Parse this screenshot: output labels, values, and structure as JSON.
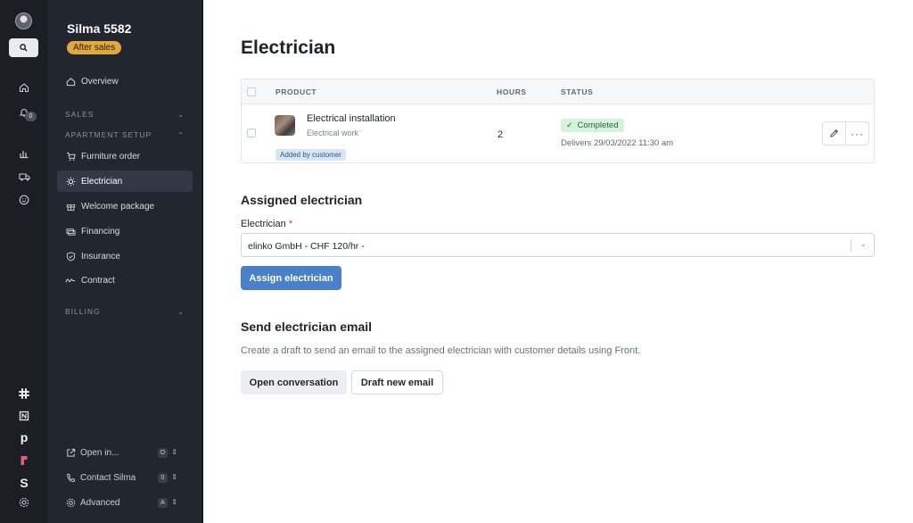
{
  "rail": {
    "icons": [
      "avatar",
      "search-icon",
      "home-icon",
      "bell-icon",
      "chart-icon",
      "truck-icon",
      "smile-icon",
      "slack-icon",
      "notion-icon",
      "pipedrive-icon",
      "figma-icon",
      "stripe-icon",
      "gear-icon"
    ],
    "notification_count": "0"
  },
  "sidebar": {
    "title": "Silma 5582",
    "badge": "After sales",
    "overview": "Overview",
    "sections": {
      "sales": "SALES",
      "apartment_setup": "APARTMENT SETUP",
      "billing": "BILLING"
    },
    "items": [
      {
        "label": "Furniture order",
        "icon": "cart-icon"
      },
      {
        "label": "Electrician",
        "icon": "bulb-icon"
      },
      {
        "label": "Welcome package",
        "icon": "gift-icon"
      },
      {
        "label": "Financing",
        "icon": "money-icon"
      },
      {
        "label": "Insurance",
        "icon": "shield-icon"
      },
      {
        "label": "Contract",
        "icon": "signature-icon"
      }
    ],
    "footer": [
      {
        "label": "Open in...",
        "shortcut": "O",
        "icon": "external-link-icon"
      },
      {
        "label": "Contact Silma",
        "shortcut": "0",
        "icon": "phone-icon"
      },
      {
        "label": "Advanced",
        "shortcut": "A",
        "icon": "gear-icon"
      }
    ],
    "active_item": "Electrician"
  },
  "main": {
    "title": "Electrician",
    "table": {
      "headers": {
        "product": "PRODUCT",
        "hours": "HOURS",
        "status": "STATUS"
      },
      "row": {
        "name": "Electrical installation",
        "subtitle": "Electrical work",
        "tag": "Added by customer",
        "hours": "2",
        "status": "Completed",
        "delivers": "Delivers 29/03/2022 11:30 am"
      }
    },
    "assigned": {
      "heading": "Assigned electrician",
      "field_label": "Electrician",
      "required_mark": "*",
      "selected_value": "elinko GmbH - CHF 120/hr -",
      "button": "Assign electrician"
    },
    "email": {
      "heading": "Send electrician email",
      "description": "Create a draft to send an email to the assigned electrician with customer details using Front.",
      "open_button": "Open conversation",
      "draft_button": "Draft new email"
    }
  },
  "colors": {
    "rail_bg": "#1b1e25",
    "sidebar_bg": "#22262e",
    "badge": "#e0a83e",
    "primary": "#4a7fc9",
    "status_green": "#d7f2dc"
  }
}
